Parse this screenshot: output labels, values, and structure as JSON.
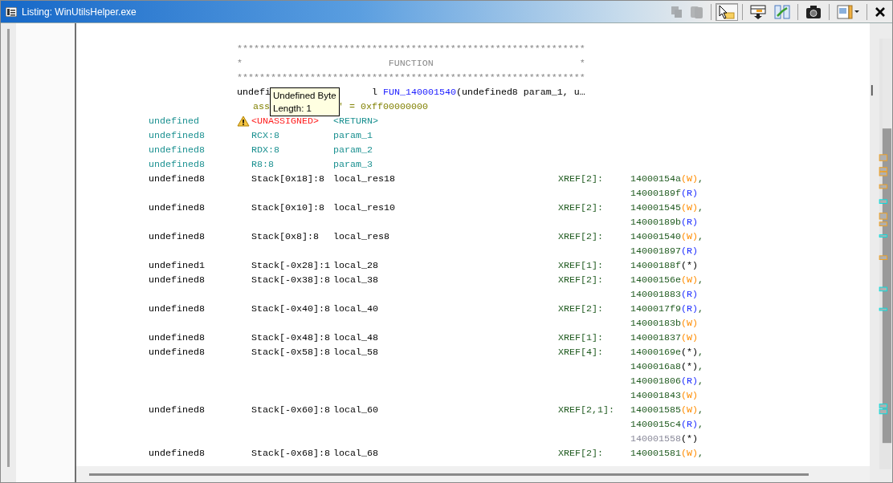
{
  "window": {
    "title": "Listing:  WinUtilsHelper.exe"
  },
  "toolbar": [
    {
      "kind": "copy",
      "disabled": true,
      "on": false
    },
    {
      "kind": "paste",
      "disabled": true,
      "on": false
    },
    {
      "kind": "cursor",
      "disabled": false,
      "on": true
    },
    {
      "kind": "field",
      "disabled": false,
      "on": false
    },
    {
      "kind": "diff",
      "disabled": false,
      "on": false
    },
    {
      "kind": "snapshot",
      "disabled": false,
      "on": false
    },
    {
      "kind": "layout",
      "disabled": false,
      "on": false
    },
    {
      "kind": "close",
      "disabled": false,
      "on": false
    }
  ],
  "header": {
    "stars_top": "**************************************************************",
    "title_line": "*                          FUNCTION                          *",
    "stars_bottom": "**************************************************************",
    "signature_left": "undefi",
    "signature_right": [
      {
        "kind": "plain",
        "text": "l "
      },
      {
        "kind": "function",
        "text": "FUN_140001540"
      },
      {
        "kind": "plain",
        "text": "(undefined8 param_1, u…"
      }
    ],
    "assign_left": "ass",
    "assign_right": "' = 0xff00000000"
  },
  "tooltip": {
    "lines": [
      "Undefined Byte",
      "Length: 1"
    ]
  },
  "variables": [
    {
      "kind": "return",
      "warning": true,
      "type": "undefined",
      "storage": "<UNASSIGNED>",
      "name": "<RETURN>"
    },
    {
      "kind": "register",
      "warning": false,
      "type": "undefined8",
      "storage": "RCX:8",
      "name": "param_1"
    },
    {
      "kind": "register",
      "warning": false,
      "type": "undefined8",
      "storage": "RDX:8",
      "name": "param_2"
    },
    {
      "kind": "register",
      "warning": false,
      "type": "undefined8",
      "storage": "R8:8",
      "name": "param_3"
    },
    {
      "kind": "stack",
      "warning": false,
      "type": "undefined8",
      "storage": "Stack[0x18]:8",
      "name": "local_res18",
      "xref": "XREF[2]:",
      "refs": [
        {
          "addr": "14000154a",
          "access": "(W)",
          "kind": "write",
          "dim": false,
          "sep": ","
        },
        {
          "addr": "14000189f",
          "access": "(R)",
          "kind": "read",
          "dim": false
        }
      ]
    },
    {
      "kind": "stack",
      "warning": false,
      "type": "undefined8",
      "storage": "Stack[0x10]:8",
      "name": "local_res10",
      "xref": "XREF[2]:",
      "refs": [
        {
          "addr": "140001545",
          "access": "(W)",
          "kind": "write",
          "dim": false,
          "sep": ","
        },
        {
          "addr": "14000189b",
          "access": "(R)",
          "kind": "read",
          "dim": false
        }
      ]
    },
    {
      "kind": "stack",
      "warning": false,
      "type": "undefined8",
      "storage": "Stack[0x8]:8",
      "name": "local_res8",
      "xref": "XREF[2]:",
      "refs": [
        {
          "addr": "140001540",
          "access": "(W)",
          "kind": "write",
          "dim": false,
          "sep": ","
        },
        {
          "addr": "140001897",
          "access": "(R)",
          "kind": "read",
          "dim": false
        }
      ]
    },
    {
      "kind": "stack",
      "warning": false,
      "type": "undefined1",
      "storage": "Stack[-0x28]:1",
      "name": "local_28",
      "xref": "XREF[1]:",
      "refs": [
        {
          "addr": "14000188f",
          "access": "(*)",
          "kind": "pointer",
          "dim": false
        }
      ]
    },
    {
      "kind": "stack",
      "warning": false,
      "type": "undefined8",
      "storage": "Stack[-0x38]:8",
      "name": "local_38",
      "xref": "XREF[2]:",
      "refs": [
        {
          "addr": "14000156e",
          "access": "(W)",
          "kind": "write",
          "dim": false,
          "sep": ","
        },
        {
          "addr": "140001883",
          "access": "(R)",
          "kind": "read",
          "dim": false
        }
      ]
    },
    {
      "kind": "stack",
      "warning": false,
      "type": "undefined8",
      "storage": "Stack[-0x40]:8",
      "name": "local_40",
      "xref": "XREF[2]:",
      "refs": [
        {
          "addr": "1400017f9",
          "access": "(R)",
          "kind": "read",
          "dim": false,
          "sep": ","
        },
        {
          "addr": "14000183b",
          "access": "(W)",
          "kind": "write",
          "dim": false
        }
      ]
    },
    {
      "kind": "stack",
      "warning": false,
      "type": "undefined8",
      "storage": "Stack[-0x48]:8",
      "name": "local_48",
      "xref": "XREF[1]:",
      "refs": [
        {
          "addr": "140001837",
          "access": "(W)",
          "kind": "write",
          "dim": false
        }
      ]
    },
    {
      "kind": "stack",
      "warning": false,
      "type": "undefined8",
      "storage": "Stack[-0x58]:8",
      "name": "local_58",
      "xref": "XREF[4]:",
      "refs": [
        {
          "addr": "14000169e",
          "access": "(*)",
          "kind": "pointer",
          "dim": false,
          "sep": ","
        },
        {
          "addr": "1400016a8",
          "access": "(*)",
          "kind": "pointer",
          "dim": false,
          "sep": ","
        },
        {
          "addr": "140001806",
          "access": "(R)",
          "kind": "read",
          "dim": false,
          "sep": ","
        },
        {
          "addr": "140001843",
          "access": "(W)",
          "kind": "write",
          "dim": false
        }
      ]
    },
    {
      "kind": "stack",
      "warning": false,
      "type": "undefined8",
      "storage": "Stack[-0x60]:8",
      "name": "local_60",
      "xref": "XREF[2,1]:",
      "refs": [
        {
          "addr": "140001585",
          "access": "(W)",
          "kind": "write",
          "dim": false,
          "sep": ","
        },
        {
          "addr": "1400015c4",
          "access": "(R)",
          "kind": "read",
          "dim": false,
          "sep": ","
        },
        {
          "addr": "140001558",
          "access": "(*)",
          "kind": "pointer",
          "dim": true
        }
      ]
    },
    {
      "kind": "stack",
      "warning": false,
      "type": "undefined8",
      "storage": "Stack[-0x68]:8",
      "name": "local_68",
      "xref": "XREF[2]:",
      "refs": [
        {
          "addr": "140001581",
          "access": "(W)",
          "kind": "write",
          "dim": false,
          "sep": ","
        }
      ]
    }
  ]
}
